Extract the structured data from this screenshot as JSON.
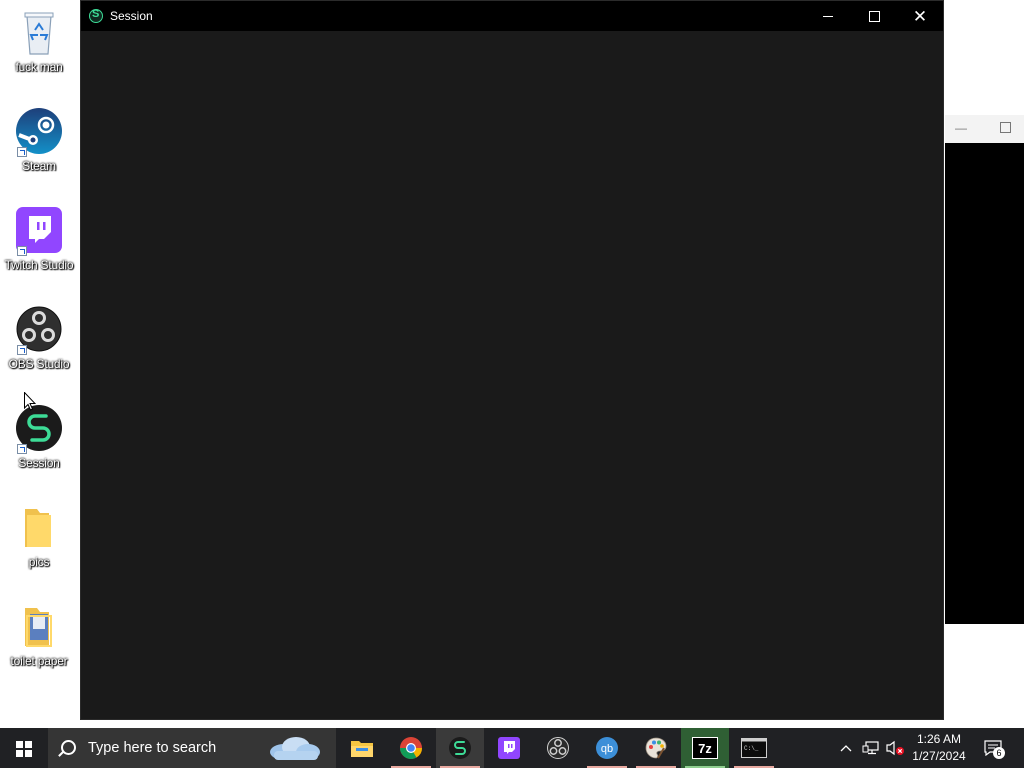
{
  "desktop": {
    "icons": [
      {
        "label": "fuck man",
        "icon": "recycle-bin-icon"
      },
      {
        "label": "Steam",
        "icon": "steam-icon"
      },
      {
        "label": "Twitch Studio",
        "icon": "twitch-studio-icon"
      },
      {
        "label": "OBS Studio",
        "icon": "obs-studio-icon"
      },
      {
        "label": "Session",
        "icon": "session-app-icon"
      },
      {
        "label": "pics",
        "icon": "folder-icon"
      },
      {
        "label": "toilet paper",
        "icon": "folder-image-icon"
      }
    ]
  },
  "window": {
    "title": "Session",
    "background_color": "#1a1a1a",
    "titlebar_color": "#000000"
  },
  "taskbar": {
    "search_placeholder": "Type here to search",
    "apps": [
      {
        "name": "File Explorer",
        "icon": "file-explorer-icon"
      },
      {
        "name": "Google Chrome",
        "icon": "chrome-icon"
      },
      {
        "name": "Session",
        "icon": "session-app-icon",
        "active": true
      },
      {
        "name": "Twitch Studio",
        "icon": "twitch-icon"
      },
      {
        "name": "OBS Studio",
        "icon": "obs-icon"
      },
      {
        "name": "qBittorrent",
        "icon": "qbittorrent-icon"
      },
      {
        "name": "Paint",
        "icon": "paint-icon"
      },
      {
        "name": "7-Zip",
        "icon": "seven-zip-icon",
        "label": "7z"
      },
      {
        "name": "Command Prompt",
        "icon": "terminal-icon",
        "label": "C:\\_"
      }
    ],
    "clock": {
      "time": "1:26 AM",
      "date": "1/27/2024"
    },
    "notifications_count": "6"
  }
}
